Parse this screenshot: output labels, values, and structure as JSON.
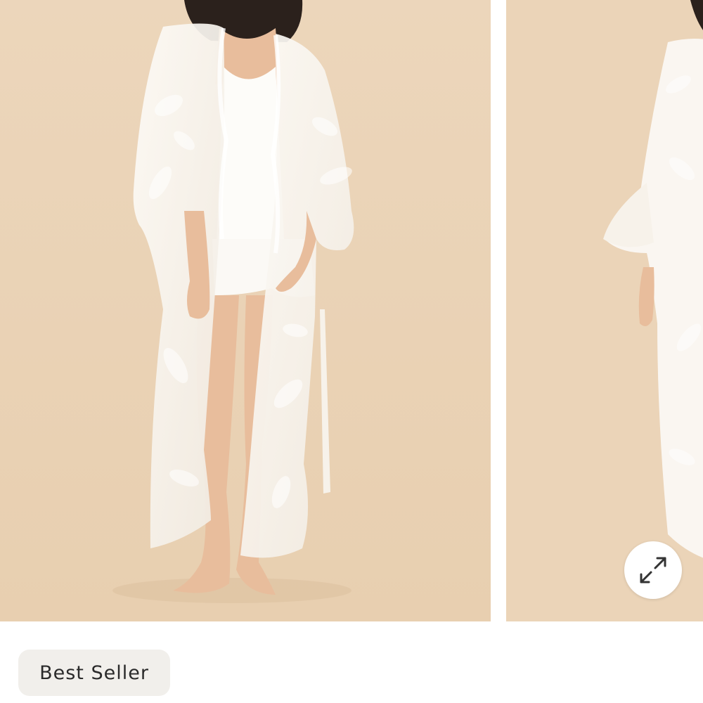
{
  "product_gallery": {
    "slides": [
      {
        "subject": "model-front-view"
      },
      {
        "subject": "model-side-view"
      }
    ],
    "expand_icon": "expand-arrows-icon"
  },
  "badge": {
    "label": "Best Seller"
  },
  "colors": {
    "backdrop": "#ead3b6",
    "garment": "#fbf8f3",
    "skin": "#e8bd9c",
    "badge_bg": "#f1efeb",
    "badge_text": "#2a2a2a"
  }
}
